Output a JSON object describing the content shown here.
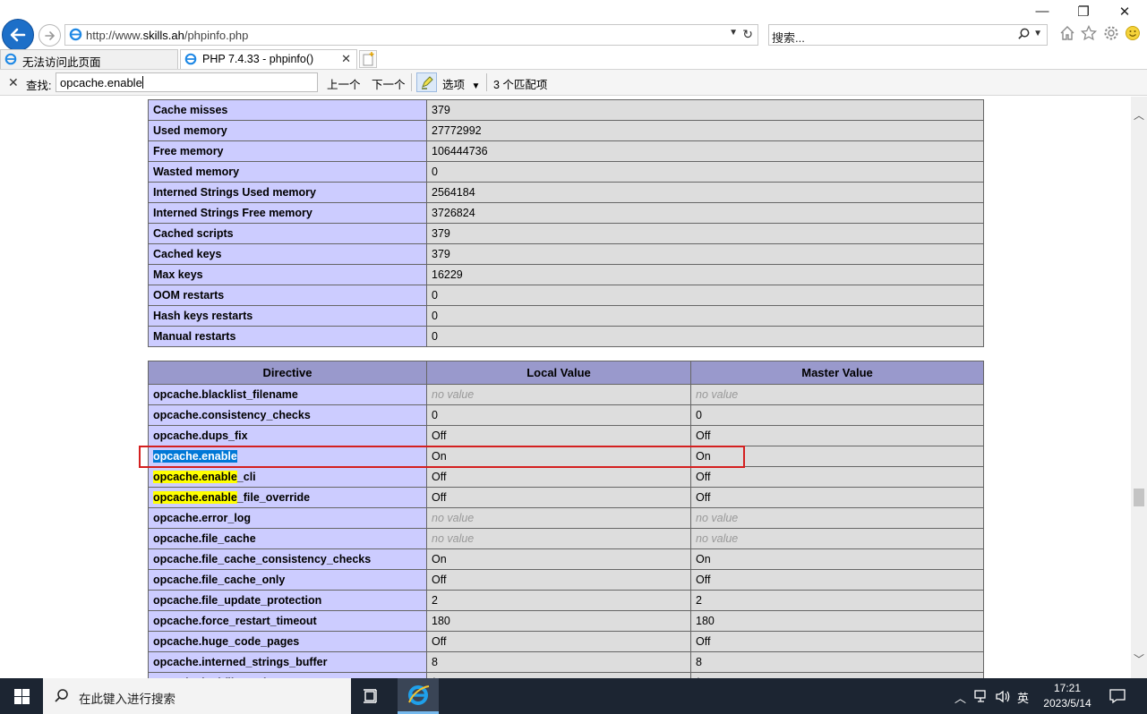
{
  "browser": {
    "url_prefix": "http://www.",
    "url_domain": "skills.ah",
    "url_path": "/phpinfo.php",
    "search_placeholder": "搜索...",
    "tabs": [
      {
        "label": "无法访问此页面"
      },
      {
        "label": "PHP 7.4.33 - phpinfo()"
      }
    ]
  },
  "find_bar": {
    "label": "查找:",
    "query": "opcache.enable",
    "prev_label": "上一个",
    "next_label": "下一个",
    "options_label": "选项",
    "match_count": "3 个匹配项"
  },
  "status_table": {
    "rows": [
      {
        "key": "Cache misses",
        "value": "379"
      },
      {
        "key": "Used memory",
        "value": "27772992"
      },
      {
        "key": "Free memory",
        "value": "106444736"
      },
      {
        "key": "Wasted memory",
        "value": "0"
      },
      {
        "key": "Interned Strings Used memory",
        "value": "2564184"
      },
      {
        "key": "Interned Strings Free memory",
        "value": "3726824"
      },
      {
        "key": "Cached scripts",
        "value": "379"
      },
      {
        "key": "Cached keys",
        "value": "379"
      },
      {
        "key": "Max keys",
        "value": "16229"
      },
      {
        "key": "OOM restarts",
        "value": "0"
      },
      {
        "key": "Hash keys restarts",
        "value": "0"
      },
      {
        "key": "Manual restarts",
        "value": "0"
      }
    ]
  },
  "directive_table": {
    "headers": [
      "Directive",
      "Local Value",
      "Master Value"
    ],
    "rows": [
      {
        "name": "opcache.blacklist_filename",
        "local": "no value",
        "master": "no value"
      },
      {
        "name": "opcache.consistency_checks",
        "local": "0",
        "master": "0"
      },
      {
        "name": "opcache.dups_fix",
        "local": "Off",
        "master": "Off"
      },
      {
        "name": "opcache.enable",
        "local": "On",
        "master": "On"
      },
      {
        "name_match": "opcache.enable",
        "name_rest": "_cli",
        "local": "Off",
        "master": "Off"
      },
      {
        "name_match": "opcache.enable",
        "name_rest": "_file_override",
        "local": "Off",
        "master": "Off"
      },
      {
        "name": "opcache.error_log",
        "local": "no value",
        "master": "no value"
      },
      {
        "name": "opcache.file_cache",
        "local": "no value",
        "master": "no value"
      },
      {
        "name": "opcache.file_cache_consistency_checks",
        "local": "On",
        "master": "On"
      },
      {
        "name": "opcache.file_cache_only",
        "local": "Off",
        "master": "Off"
      },
      {
        "name": "opcache.file_update_protection",
        "local": "2",
        "master": "2"
      },
      {
        "name": "opcache.force_restart_timeout",
        "local": "180",
        "master": "180"
      },
      {
        "name": "opcache.huge_code_pages",
        "local": "Off",
        "master": "Off"
      },
      {
        "name": "opcache.interned_strings_buffer",
        "local": "8",
        "master": "8"
      },
      {
        "name": "opcache.lockfile_path",
        "local": "/tmp",
        "master": "/tmp"
      }
    ]
  },
  "taskbar": {
    "search_placeholder": "在此键入进行搜索",
    "ime": "英",
    "time": "17:21",
    "date": "2023/5/14"
  },
  "colors": {
    "php_key_bg": "#ccccff",
    "php_value_bg": "#dddddd",
    "php_header_bg": "#9999cc",
    "selection": "#0078d7",
    "find_highlight": "#ffff00",
    "annotation_box": "#d42020",
    "taskbar_bg": "#1c2532"
  }
}
